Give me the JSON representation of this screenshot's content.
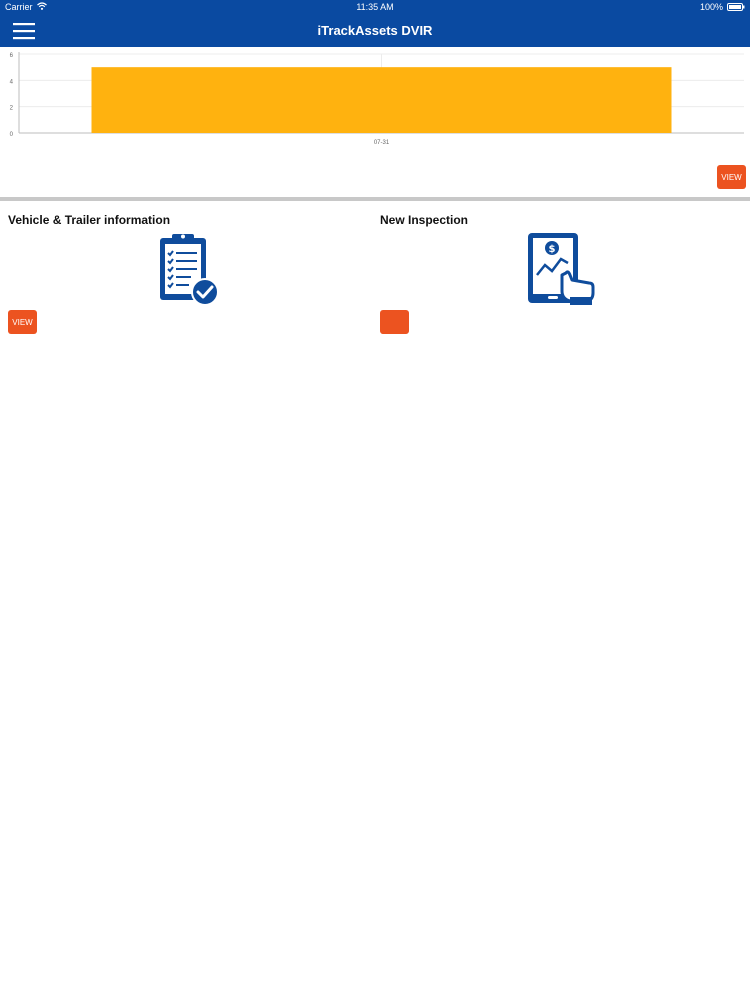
{
  "status_bar": {
    "carrier": "Carrier",
    "time": "11:35 AM",
    "battery": "100%"
  },
  "nav": {
    "title": "iTrackAssets DVIR",
    "menu_icon": "hamburger-menu-icon"
  },
  "chart_data": {
    "type": "bar",
    "categories": [
      "07-31"
    ],
    "values": [
      5
    ],
    "ylim": [
      0,
      6
    ],
    "y_ticks": [
      0,
      2,
      4,
      6
    ],
    "grid": true,
    "bar_color": "#ffb20f"
  },
  "chart_view_button": {
    "label": "VIEW"
  },
  "tiles": [
    {
      "title": "Vehicle & Trailer information",
      "button_label": "VIEW",
      "icon": "clipboard-check-icon"
    },
    {
      "title": "New Inspection",
      "button_label": "",
      "icon": "tablet-touch-icon"
    }
  ],
  "colors": {
    "brand": "#0a4aa1",
    "accent": "#ec5320",
    "bar": "#ffb20f",
    "icon": "#0f4c9c"
  }
}
